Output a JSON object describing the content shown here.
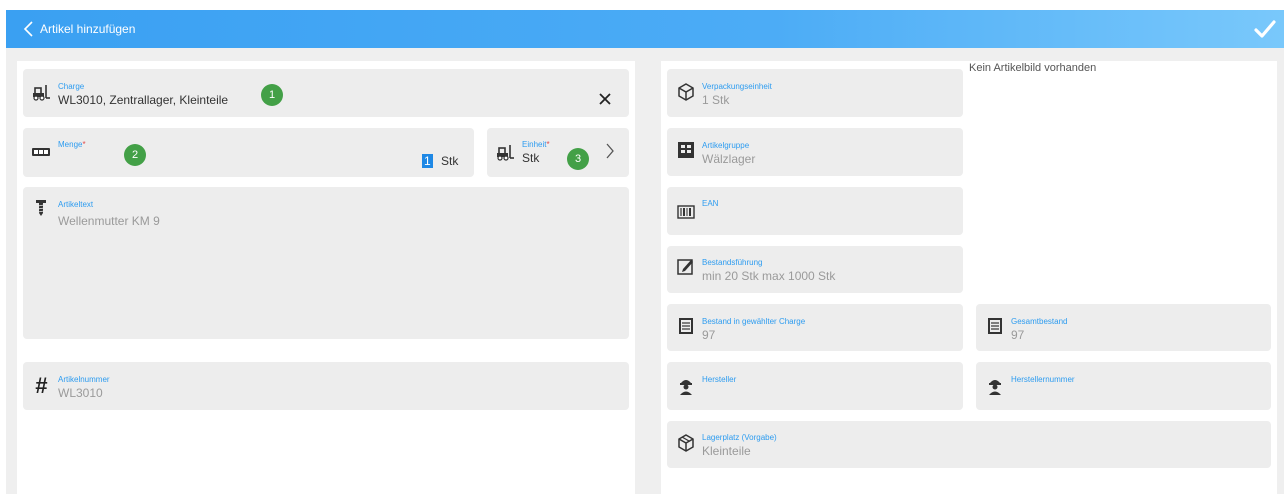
{
  "header": {
    "title": "Artikel hinzufügen"
  },
  "left": {
    "charge": {
      "label": "Charge",
      "value": "WL3010, Zentrallager, Kleinteile",
      "badge": "1"
    },
    "menge": {
      "label": "Menge",
      "required": "*",
      "value": "1",
      "unit": "Stk",
      "badge": "2"
    },
    "einheit": {
      "label": "Einheit",
      "required": "*",
      "value": "Stk",
      "badge": "3"
    },
    "artikeltext": {
      "label": "Artikeltext",
      "value": "Wellenmutter KM 9"
    },
    "artikelnummer": {
      "label": "Artikelnummer",
      "value": "WL3010"
    }
  },
  "right": {
    "verpackungseinheit": {
      "label": "Verpackungseinheit",
      "value": "1 Stk"
    },
    "artikelgruppe": {
      "label": "Artikelgruppe",
      "value": "Wälzlager"
    },
    "ean": {
      "label": "EAN"
    },
    "bestandsfuehrung": {
      "label": "Bestandsführung",
      "value": "min 20  Stk max 1000  Stk"
    },
    "bestand_charge": {
      "label": "Bestand in gewählter Charge",
      "value": "97"
    },
    "gesamtbestand": {
      "label": "Gesamtbestand",
      "value": "97"
    },
    "hersteller": {
      "label": "Hersteller"
    },
    "herstellernummer": {
      "label": "Herstellernummer"
    },
    "lagerplatz": {
      "label": "Lagerplatz (Vorgabe)",
      "value": "Kleinteile"
    },
    "image_placeholder": "Kein Artikelbild vorhanden"
  },
  "colors": {
    "accent": "#2d9cf0",
    "header": "#4cacf6",
    "badge": "#43a047",
    "card": "#ededed"
  }
}
